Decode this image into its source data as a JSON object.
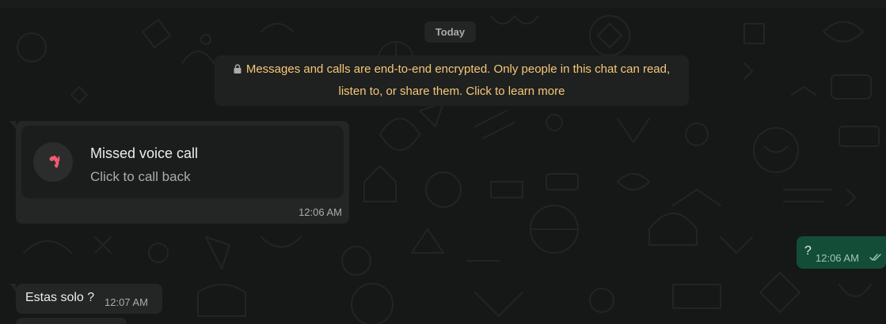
{
  "chat": {
    "date_chip": "Today",
    "encryption_notice": "Messages and calls are end-to-end encrypted. Only people in this chat can read, listen to, or share them. Click to learn more",
    "messages": [
      {
        "type": "missed-call",
        "title": "Missed voice call",
        "subtitle": "Click to call back",
        "time": "12:06 AM",
        "icon": "missed-call-icon"
      },
      {
        "type": "outgoing",
        "text": "?",
        "time": "12:06 AM",
        "status_icon": "double-check-icon"
      },
      {
        "type": "incoming",
        "text": "Estas solo ?",
        "time": "12:07 AM"
      }
    ]
  },
  "colors": {
    "background": "#161717",
    "incoming_bubble": "#242626",
    "outgoing_bubble": "#144d37",
    "notice_text": "#f5c978",
    "missed_call_red": "#f15c6d"
  }
}
